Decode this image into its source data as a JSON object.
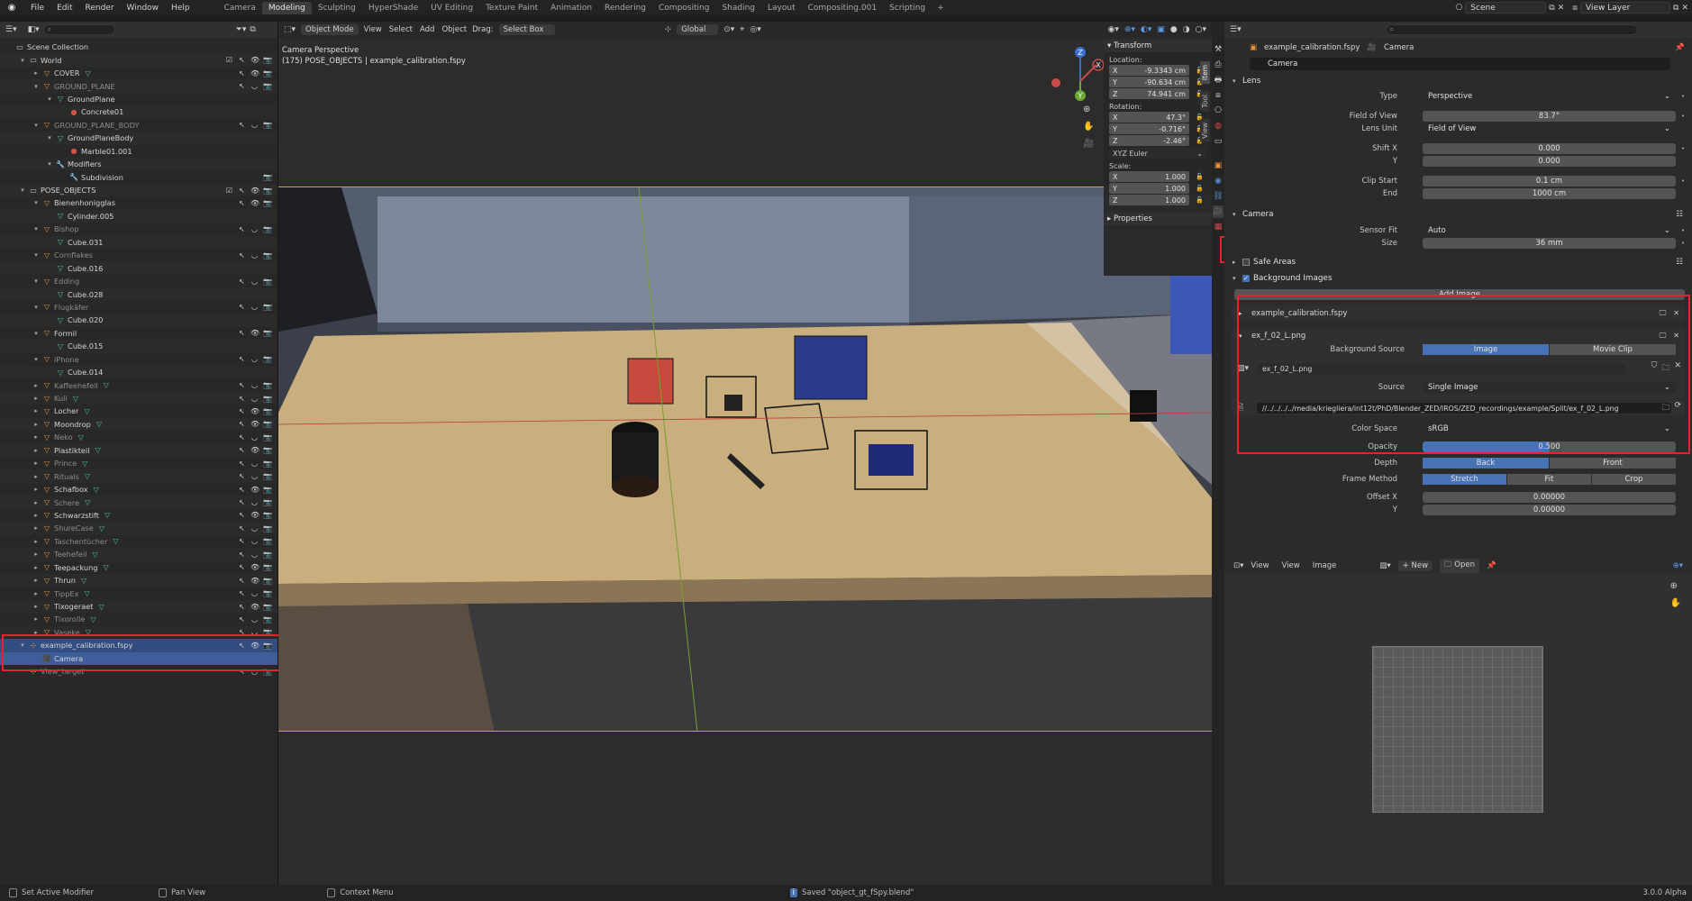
{
  "menu": [
    "File",
    "Edit",
    "Render",
    "Window",
    "Help"
  ],
  "workspaces": [
    "Camera",
    "Modeling",
    "Sculpting",
    "HyperShade",
    "UV Editing",
    "Texture Paint",
    "Animation",
    "Rendering",
    "Compositing",
    "Shading",
    "Layout",
    "Compositing.001",
    "Scripting"
  ],
  "active_workspace": "Modeling",
  "scene_name": "Scene",
  "view_layer": "View Layer",
  "outliner": {
    "rows": [
      {
        "depth": 0,
        "tri": "",
        "icon": "coll",
        "text": "Scene Collection",
        "mesh": false,
        "tail": "",
        "dim": false
      },
      {
        "depth": 1,
        "tri": "▾",
        "icon": "coll",
        "text": "World",
        "mesh": false,
        "tail": "☑ ↖ 👁 📷",
        "dim": false
      },
      {
        "depth": 2,
        "tri": "▸",
        "icon": "obj",
        "text": "COVER",
        "mesh": true,
        "tail": "↖ 👁 📷",
        "dim": false
      },
      {
        "depth": 2,
        "tri": "▾",
        "icon": "obj",
        "text": "GROUND_PLANE",
        "mesh": false,
        "tail": "↖ ◡ 📷",
        "dim": true
      },
      {
        "depth": 3,
        "tri": "▾",
        "icon": "mesh",
        "text": "GroundPlane",
        "mesh": false,
        "tail": "",
        "dim": false
      },
      {
        "depth": 4,
        "tri": "",
        "icon": "mat",
        "text": "Concrete01",
        "mesh": false,
        "tail": "",
        "dim": false
      },
      {
        "depth": 2,
        "tri": "▾",
        "icon": "obj",
        "text": "GROUND_PLANE_BODY",
        "mesh": false,
        "tail": "↖ ◡ 📷",
        "dim": true
      },
      {
        "depth": 3,
        "tri": "▾",
        "icon": "mesh",
        "text": "GroundPlaneBody",
        "mesh": false,
        "tail": "",
        "dim": false
      },
      {
        "depth": 4,
        "tri": "",
        "icon": "mat",
        "text": "Marble01.001",
        "mesh": false,
        "tail": "",
        "dim": false
      },
      {
        "depth": 3,
        "tri": "▾",
        "icon": "mod",
        "text": "Modifiers",
        "mesh": false,
        "tail": "",
        "dim": false
      },
      {
        "depth": 4,
        "tri": "",
        "icon": "mod",
        "text": "Subdivision",
        "mesh": false,
        "tail": "📷",
        "dim": false
      },
      {
        "depth": 1,
        "tri": "▾",
        "icon": "coll",
        "text": "POSE_OBJECTS",
        "mesh": false,
        "tail": "☑ ↖ 👁 📷",
        "dim": false
      },
      {
        "depth": 2,
        "tri": "▾",
        "icon": "obj",
        "text": "Bienenhonigglas",
        "mesh": false,
        "tail": "↖ 👁 📷",
        "dim": false
      },
      {
        "depth": 3,
        "tri": "",
        "icon": "mesh",
        "text": "Cylinder.005",
        "mesh": false,
        "tail": "",
        "dim": false
      },
      {
        "depth": 2,
        "tri": "▾",
        "icon": "obj",
        "text": "Bishop",
        "mesh": false,
        "tail": "↖ ◡ 📷",
        "dim": true
      },
      {
        "depth": 3,
        "tri": "",
        "icon": "mesh",
        "text": "Cube.031",
        "mesh": false,
        "tail": "",
        "dim": false
      },
      {
        "depth": 2,
        "tri": "▾",
        "icon": "obj",
        "text": "Cornflakes",
        "mesh": false,
        "tail": "↖ ◡ 📷",
        "dim": true
      },
      {
        "depth": 3,
        "tri": "",
        "icon": "mesh",
        "text": "Cube.016",
        "mesh": false,
        "tail": "",
        "dim": false
      },
      {
        "depth": 2,
        "tri": "▾",
        "icon": "obj",
        "text": "Edding",
        "mesh": false,
        "tail": "↖ ◡ 📷",
        "dim": true
      },
      {
        "depth": 3,
        "tri": "",
        "icon": "mesh",
        "text": "Cube.028",
        "mesh": false,
        "tail": "",
        "dim": false
      },
      {
        "depth": 2,
        "tri": "▾",
        "icon": "obj",
        "text": "Flugkäfer",
        "mesh": false,
        "tail": "↖ ◡ 📷",
        "dim": true
      },
      {
        "depth": 3,
        "tri": "",
        "icon": "mesh",
        "text": "Cube.020",
        "mesh": false,
        "tail": "",
        "dim": false
      },
      {
        "depth": 2,
        "tri": "▾",
        "icon": "obj",
        "text": "Formil",
        "mesh": false,
        "tail": "↖ 👁 📷",
        "dim": false
      },
      {
        "depth": 3,
        "tri": "",
        "icon": "mesh",
        "text": "Cube.015",
        "mesh": false,
        "tail": "",
        "dim": false
      },
      {
        "depth": 2,
        "tri": "▾",
        "icon": "obj",
        "text": "iPhone",
        "mesh": false,
        "tail": "↖ ◡ 📷",
        "dim": true
      },
      {
        "depth": 3,
        "tri": "",
        "icon": "mesh",
        "text": "Cube.014",
        "mesh": false,
        "tail": "",
        "dim": false
      },
      {
        "depth": 2,
        "tri": "▸",
        "icon": "obj",
        "text": "Kaffeehefeil",
        "mesh": true,
        "tail": "↖ ◡ 📷",
        "dim": true
      },
      {
        "depth": 2,
        "tri": "▸",
        "icon": "obj",
        "text": "Kuli",
        "mesh": true,
        "tail": "↖ ◡ 📷",
        "dim": true
      },
      {
        "depth": 2,
        "tri": "▸",
        "icon": "obj",
        "text": "Locher",
        "mesh": true,
        "tail": "↖ 👁 📷",
        "dim": false
      },
      {
        "depth": 2,
        "tri": "▸",
        "icon": "obj",
        "text": "Moondrop",
        "mesh": true,
        "tail": "↖ 👁 📷",
        "dim": false
      },
      {
        "depth": 2,
        "tri": "▸",
        "icon": "obj",
        "text": "Neko",
        "mesh": true,
        "tail": "↖ ◡ 📷",
        "dim": true
      },
      {
        "depth": 2,
        "tri": "▸",
        "icon": "obj",
        "text": "Plastikteil",
        "mesh": true,
        "tail": "↖ 👁 📷",
        "dim": false
      },
      {
        "depth": 2,
        "tri": "▸",
        "icon": "obj",
        "text": "Prince",
        "mesh": true,
        "tail": "↖ ◡ 📷",
        "dim": true
      },
      {
        "depth": 2,
        "tri": "▸",
        "icon": "obj",
        "text": "Rituals",
        "mesh": true,
        "tail": "↖ ◡ 📷",
        "dim": true
      },
      {
        "depth": 2,
        "tri": "▸",
        "icon": "obj",
        "text": "Schafbox",
        "mesh": true,
        "tail": "↖ 👁 📷",
        "dim": false
      },
      {
        "depth": 2,
        "tri": "▸",
        "icon": "obj",
        "text": "Schere",
        "mesh": true,
        "tail": "↖ ◡ 📷",
        "dim": true
      },
      {
        "depth": 2,
        "tri": "▸",
        "icon": "obj",
        "text": "Schwarzstift",
        "mesh": true,
        "tail": "↖ 👁 📷",
        "dim": false
      },
      {
        "depth": 2,
        "tri": "▸",
        "icon": "obj",
        "text": "ShureCase",
        "mesh": true,
        "tail": "↖ ◡ 📷",
        "dim": true
      },
      {
        "depth": 2,
        "tri": "▸",
        "icon": "obj",
        "text": "Taschentücher",
        "mesh": true,
        "tail": "↖ ◡ 📷",
        "dim": true
      },
      {
        "depth": 2,
        "tri": "▸",
        "icon": "obj",
        "text": "Teehefeil",
        "mesh": true,
        "tail": "↖ ◡ 📷",
        "dim": true
      },
      {
        "depth": 2,
        "tri": "▸",
        "icon": "obj",
        "text": "Teepackung",
        "mesh": true,
        "tail": "↖ 👁 📷",
        "dim": false
      },
      {
        "depth": 2,
        "tri": "▸",
        "icon": "obj",
        "text": "Thrun",
        "mesh": true,
        "tail": "↖ 👁 📷",
        "dim": false
      },
      {
        "depth": 2,
        "tri": "▸",
        "icon": "obj",
        "text": "TippEx",
        "mesh": true,
        "tail": "↖ ◡ 📷",
        "dim": true
      },
      {
        "depth": 2,
        "tri": "▸",
        "icon": "obj",
        "text": "Tixogeraet",
        "mesh": true,
        "tail": "↖ 👁 📷",
        "dim": false
      },
      {
        "depth": 2,
        "tri": "▸",
        "icon": "obj",
        "text": "Tixorolle",
        "mesh": true,
        "tail": "↖ ◡ 📷",
        "dim": true
      },
      {
        "depth": 2,
        "tri": "▸",
        "icon": "obj",
        "text": "Vaseke",
        "mesh": true,
        "tail": "↖ ◡ 📷",
        "dim": true
      },
      {
        "depth": 1,
        "tri": "▾",
        "icon": "empty",
        "text": "example_calibration.fspy",
        "mesh": false,
        "tail": "↖ 👁 📷",
        "dim": false,
        "selected": true
      },
      {
        "depth": 2,
        "tri": "",
        "icon": "cam",
        "text": "Camera",
        "mesh": false,
        "tail": "",
        "dim": false,
        "child_selected": true
      },
      {
        "depth": 1,
        "tri": "",
        "icon": "empty",
        "text": "View_target",
        "mesh": false,
        "tail": "↖ ◡ 📷",
        "dim": true
      }
    ]
  },
  "viewport": {
    "mode": "Object Mode",
    "menus": [
      "View",
      "Select",
      "Add",
      "Object"
    ],
    "drag_label": "Drag:",
    "drag_value": "Select Box",
    "orientation": "Global",
    "info_line1": "Camera Perspective",
    "info_line2": "(175) POSE_OBJECTS | example_calibration.fspy",
    "gizmo": {
      "x": "X",
      "y": "Y",
      "z": "Z"
    },
    "npanel": {
      "tabs": [
        "Item",
        "Tool",
        "View"
      ],
      "transform_title": "Transform",
      "location_label": "Location:",
      "location": [
        {
          "axis": "X",
          "value": "-9.3343 cm"
        },
        {
          "axis": "Y",
          "value": "-90.634 cm"
        },
        {
          "axis": "Z",
          "value": "74.941 cm"
        }
      ],
      "rotation_label": "Rotation:",
      "rotation": [
        {
          "axis": "X",
          "value": "47.3°"
        },
        {
          "axis": "Y",
          "value": "-0.716°"
        },
        {
          "axis": "Z",
          "value": "-2.46°"
        }
      ],
      "rotation_mode": "XYZ Euler",
      "scale_label": "Scale:",
      "scale": [
        {
          "axis": "X",
          "value": "1.000"
        },
        {
          "axis": "Y",
          "value": "1.000"
        },
        {
          "axis": "Z",
          "value": "1.000"
        }
      ],
      "properties_title": "Properties"
    }
  },
  "properties": {
    "breadcrumb_object": "example_calibration.fspy",
    "breadcrumb_data": "Camera",
    "data_name": "Camera",
    "lens_title": "Lens",
    "type_label": "Type",
    "type_value": "Perspective",
    "fov_label": "Field of View",
    "fov_value": "83.7°",
    "lens_unit_label": "Lens Unit",
    "lens_unit_value": "Field of View",
    "shiftx_label": "Shift X",
    "shiftx_value": "0.000",
    "shifty_label": "Y",
    "shifty_value": "0.000",
    "clip_start_label": "Clip Start",
    "clip_start_value": "0.1 cm",
    "clip_end_label": "End",
    "clip_end_value": "1000 cm",
    "camera_title": "Camera",
    "sensor_fit_label": "Sensor Fit",
    "sensor_fit_value": "Auto",
    "size_label": "Size",
    "size_value": "36 mm",
    "safe_areas_title": "Safe Areas",
    "bg_title": "Background Images",
    "add_image": "Add Image",
    "bg_item1": "example_calibration.fspy",
    "bg_item2": "ex_f_02_L.png",
    "bg_source_label": "Background Source",
    "bg_source_image": "Image",
    "bg_source_clip": "Movie Clip",
    "image_name": "ex_f_02_L.png",
    "source_label": "Source",
    "source_value": "Single Image",
    "filepath": "//../../../../media/kriegliera/int12t/PhD/Blender_ZED/IROS/ZED_recordings/example/Split/ex_f_02_L.png",
    "color_space_label": "Color Space",
    "color_space_value": "sRGB",
    "opacity_label": "Opacity",
    "opacity_value": "0.500",
    "depth_label": "Depth",
    "depth_back": "Back",
    "depth_front": "Front",
    "frame_method_label": "Frame Method",
    "fm_stretch": "Stretch",
    "fm_fit": "Fit",
    "fm_crop": "Crop",
    "offsetx_label": "Offset X",
    "offsetx_value": "0.00000",
    "offsety_label": "Y",
    "offsety_value": "0.00000"
  },
  "image_editor": {
    "menus": [
      "View",
      "View",
      "Image"
    ],
    "new_label": "New",
    "open_label": "Open"
  },
  "status": {
    "left": "Set Active Modifier",
    "pan": "Pan View",
    "context": "Context Menu",
    "saved": "Saved \"object_gt_fSpy.blend\"",
    "version": "3.0.0 Alpha"
  },
  "colors": {
    "accent": "#4772b3",
    "highlight": "#e0262c",
    "selected_row": "#334d80"
  }
}
